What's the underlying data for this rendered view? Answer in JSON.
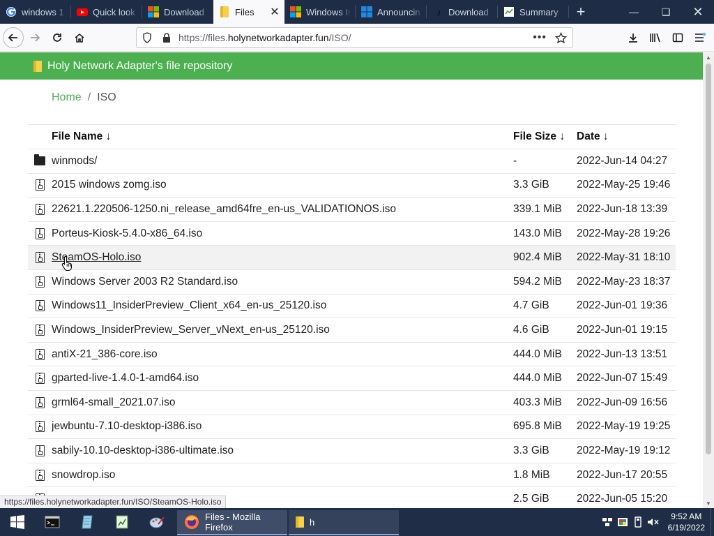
{
  "tabs": [
    {
      "label": "windows 1",
      "icon": "google-icon"
    },
    {
      "label": "Quick look",
      "icon": "youtube-icon"
    },
    {
      "label": "Download",
      "icon": "microsoft-icon"
    },
    {
      "label": "Files",
      "icon": "folder-icon",
      "active": true
    },
    {
      "label": "Windows In",
      "icon": "microsoft-icon"
    },
    {
      "label": "Announcin",
      "icon": "windows-icon"
    },
    {
      "label": "Download",
      "icon": "dark-site-icon"
    },
    {
      "label": "Summary",
      "icon": "summary-icon"
    }
  ],
  "url": {
    "prefix": "https://files.",
    "domain": "holynetworkadapter.fun",
    "path": "/ISO/"
  },
  "site": {
    "title": "Holy Network Adapter's file repository",
    "breadcrumb": {
      "home": "Home",
      "current": "ISO"
    }
  },
  "table": {
    "headers": {
      "name": "File Name ↓",
      "size": "File Size ↓",
      "date": "Date ↓"
    },
    "rows": [
      {
        "type": "folder",
        "name": "winmods/",
        "size": "-",
        "date": "2022-Jun-14 04:27"
      },
      {
        "type": "file",
        "name": "2015 windows zomg.iso",
        "size": "3.3 GiB",
        "date": "2022-May-25 19:46"
      },
      {
        "type": "file",
        "name": "22621.1.220506-1250.ni_release_amd64fre_en-us_VALIDATIONOS.iso",
        "size": "339.1 MiB",
        "date": "2022-Jun-18 13:39"
      },
      {
        "type": "file",
        "name": "Porteus-Kiosk-5.4.0-x86_64.iso",
        "size": "143.0 MiB",
        "date": "2022-May-28 19:26"
      },
      {
        "type": "file",
        "name": "SteamOS-Holo.iso",
        "size": "902.4 MiB",
        "date": "2022-May-31 18:10",
        "hover": true
      },
      {
        "type": "file",
        "name": "Windows Server 2003 R2 Standard.iso",
        "size": "594.2 MiB",
        "date": "2022-May-23 18:37"
      },
      {
        "type": "file",
        "name": "Windows11_InsiderPreview_Client_x64_en-us_25120.iso",
        "size": "4.7 GiB",
        "date": "2022-Jun-01 19:36"
      },
      {
        "type": "file",
        "name": "Windows_InsiderPreview_Server_vNext_en-us_25120.iso",
        "size": "4.6 GiB",
        "date": "2022-Jun-01 19:15"
      },
      {
        "type": "file",
        "name": "antiX-21_386-core.iso",
        "size": "444.0 MiB",
        "date": "2022-Jun-13 13:51"
      },
      {
        "type": "file",
        "name": "gparted-live-1.4.0-1-amd64.iso",
        "size": "444.0 MiB",
        "date": "2022-Jun-07 15:49"
      },
      {
        "type": "file",
        "name": "grml64-small_2021.07.iso",
        "size": "403.3 MiB",
        "date": "2022-Jun-09 16:56"
      },
      {
        "type": "file",
        "name": "jewbuntu-7.10-desktop-i386.iso",
        "size": "695.8 MiB",
        "date": "2022-May-19 19:25"
      },
      {
        "type": "file",
        "name": "sabily-10.10-desktop-i386-ultimate.iso",
        "size": "3.3 GiB",
        "date": "2022-May-19 19:12"
      },
      {
        "type": "file",
        "name": "snowdrop.iso",
        "size": "1.8 MiB",
        "date": "2022-Jun-17 20:55"
      },
      {
        "type": "file",
        "name": "",
        "size": "2.5 GiB",
        "date": "2022-Jun-05 15:20"
      }
    ]
  },
  "status_link": "https://files.holynetworkadapter.fun/ISO/SteamOS-Holo.iso",
  "taskbar": {
    "apps": [
      {
        "label": "Files - Mozilla Firefox",
        "icon": "firefox-icon",
        "active": true
      },
      {
        "label": "h",
        "icon": "folder-icon",
        "active": false
      }
    ],
    "time": "9:52 AM",
    "date": "6/19/2022"
  },
  "colors": {
    "accent": "#4caf50",
    "tabbar": "#1e2c45",
    "taskbar": "#1f2d47"
  }
}
